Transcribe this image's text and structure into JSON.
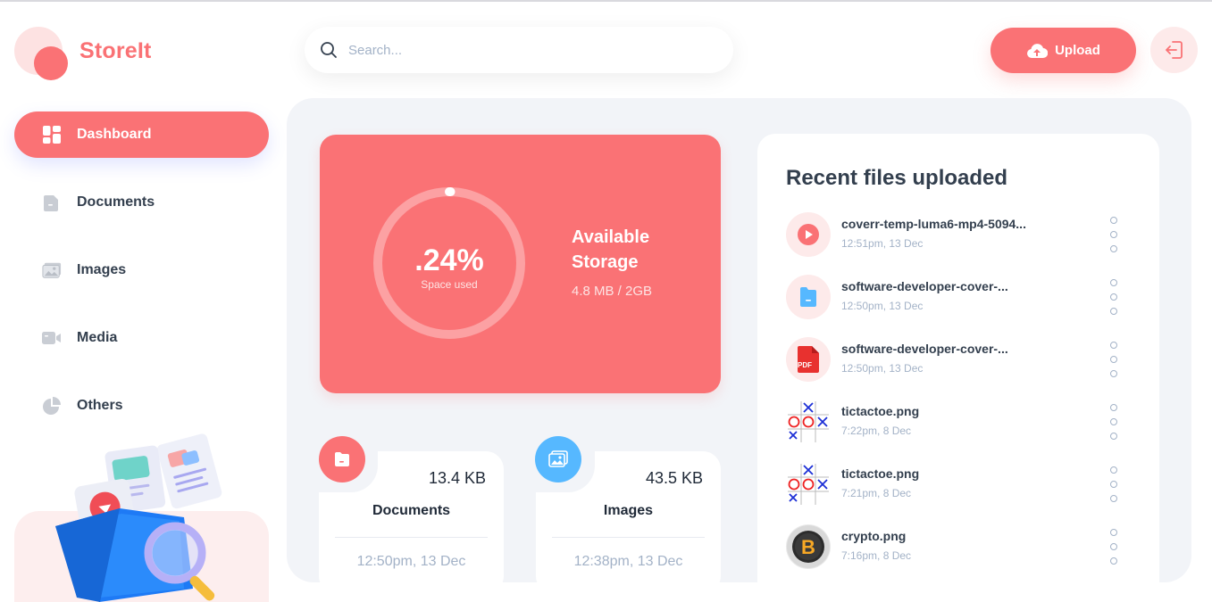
{
  "app": {
    "name": "StoreIt"
  },
  "search": {
    "placeholder": "Search..."
  },
  "header": {
    "upload_label": "Upload"
  },
  "sidebar": {
    "items": [
      {
        "label": "Dashboard",
        "icon": "dashboard-icon",
        "active": true
      },
      {
        "label": "Documents",
        "icon": "documents-icon",
        "active": false
      },
      {
        "label": "Images",
        "icon": "images-icon",
        "active": false
      },
      {
        "label": "Media",
        "icon": "media-icon",
        "active": false
      },
      {
        "label": "Others",
        "icon": "others-icon",
        "active": false
      }
    ]
  },
  "storage": {
    "percent_label": ".24%",
    "percent_value": 0.24,
    "sub_label": "Space used",
    "title": "Available Storage",
    "usage": "4.8 MB / 2GB"
  },
  "summary": [
    {
      "title": "Documents",
      "size": "13.4 KB",
      "time": "12:50pm, 13 Dec",
      "icon": "folder-icon",
      "color": "#fa7275"
    },
    {
      "title": "Images",
      "size": "43.5 KB",
      "time": "12:38pm, 13 Dec",
      "icon": "image-icon",
      "color": "#56b8ff"
    }
  ],
  "recent": {
    "title": "Recent files uploaded",
    "files": [
      {
        "name": "coverr-temp-luma6-mp4-5094...",
        "date": "12:51pm, 13 Dec",
        "icon": "video-icon"
      },
      {
        "name": "software-developer-cover-...",
        "date": "12:50pm, 13 Dec",
        "icon": "document-icon"
      },
      {
        "name": "software-developer-cover-...",
        "date": "12:50pm, 13 Dec",
        "icon": "pdf-icon",
        "badge": "PDF"
      },
      {
        "name": "tictactoe.png",
        "date": "7:22pm, 8 Dec",
        "icon": "tictactoe-thumbnail"
      },
      {
        "name": "tictactoe.png",
        "date": "7:21pm, 8 Dec",
        "icon": "tictactoe-thumbnail"
      },
      {
        "name": "crypto.png",
        "date": "7:16pm, 8 Dec",
        "icon": "bitcoin-thumbnail",
        "badge": "B"
      }
    ]
  },
  "colors": {
    "brand": "#fa7275",
    "blue": "#56b8ff",
    "text": "#333f4e",
    "muted": "#a3b2c7",
    "panel": "#f2f4f8"
  }
}
